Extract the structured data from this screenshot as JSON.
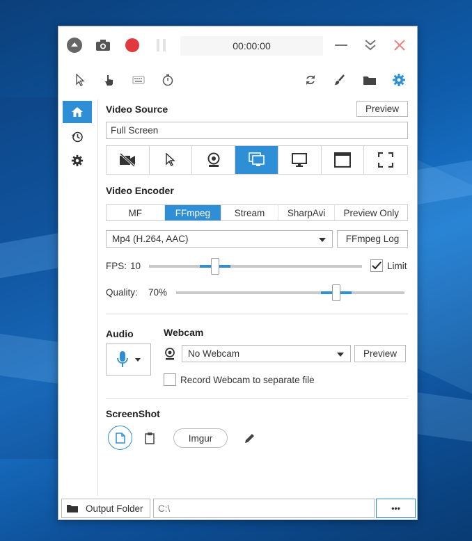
{
  "window": {
    "timer": "00:00:00"
  },
  "video_source": {
    "title": "Video Source",
    "preview_label": "Preview",
    "selected": "Full Screen",
    "source_icons": [
      "no-video-icon",
      "cursor-region-icon",
      "webcam-icon",
      "screen-icon",
      "monitor-icon",
      "window-icon",
      "fullscreen-region-icon"
    ],
    "active_index": 3
  },
  "video_encoder": {
    "title": "Video Encoder",
    "tabs": [
      "MF",
      "FFmpeg",
      "Stream",
      "SharpAvi",
      "Preview Only"
    ],
    "active_tab": 1,
    "codec": "Mp4 (H.264, AAC)",
    "log_label": "FFmpeg Log",
    "fps_label": "FPS:",
    "fps_value": "10",
    "fps_fraction": 0.31,
    "limit_label": "Limit",
    "limit_checked": true,
    "quality_label": "Quality:",
    "quality_value": "70%",
    "quality_fraction": 0.7
  },
  "audio": {
    "title": "Audio"
  },
  "webcam": {
    "title": "Webcam",
    "selected": "No Webcam",
    "preview_label": "Preview",
    "separate_file_label": "Record Webcam to separate file",
    "separate_file_checked": false
  },
  "screenshot": {
    "title": "ScreenShot",
    "imgur_label": "Imgur"
  },
  "status": {
    "output_folder_label": "Output Folder",
    "path": "C:\\",
    "more_label": "•••"
  },
  "colors": {
    "accent": "#2f8fd6",
    "record": "#e0393e",
    "close": "#f08080"
  }
}
